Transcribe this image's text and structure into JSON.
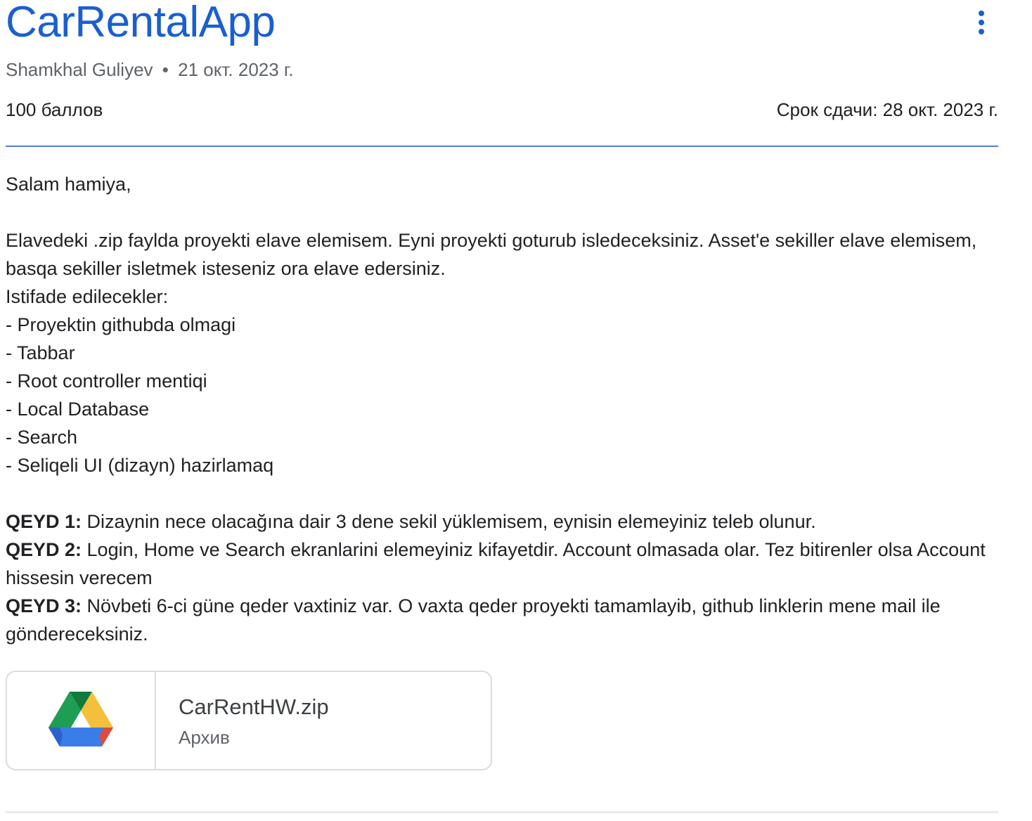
{
  "header": {
    "title": "CarRentalApp",
    "author": "Shamkhal Guliyev",
    "separator": "•",
    "date": "21 окт. 2023 г.",
    "points": "100 баллов",
    "due": "Срок сдачи: 28 окт. 2023 г.",
    "more_icon": "more-vert-icon"
  },
  "content": {
    "greeting": "Salam hamiya,",
    "intro": "Elavedeki .zip faylda proyekti elave elemisem. Eyni proyekti goturub isledeceksiniz. Asset'e sekiller elave elemisem, basqa sekiller isletmek isteseniz ora elave edersiniz.",
    "list_title": "Istifade edilecekler:",
    "items": [
      "- Proyektin githubda olmagi",
      "- Tabbar",
      "- Root controller mentiqi",
      "- Local Database",
      "- Search",
      "- Seliqeli UI (dizayn) hazirlamaq"
    ],
    "notes": [
      {
        "label": "QEYD 1:",
        "text": " Dizaynin nece olacağına dair 3 dene sekil yüklemisem, eynisin elemeyiniz teleb olunur."
      },
      {
        "label": "QEYD 2:",
        "text": " Login, Home ve Search ekranlarini elemeyiniz kifayetdir. Account olmasada olar. Tez bitirenler olsa Account hissesin verecem"
      },
      {
        "label": "QEYD 3:",
        "text": " Növbeti 6-ci güne qeder vaxtiniz var. O vaxta qeder proyekti tamamlayib, github linklerin mene mail ile göndereceksiniz."
      }
    ]
  },
  "attachment": {
    "name": "CarRentHW.zip",
    "type": "Архив",
    "icon": "google-drive-icon"
  },
  "colors": {
    "accent": "#1a5fcf",
    "divider": "#4f7fdc",
    "drive_green": "#1e9e52",
    "drive_yellow": "#f4bf3a",
    "drive_blue": "#3b7de8",
    "drive_red": "#e04b3a",
    "drive_dark_green": "#117a3d"
  }
}
